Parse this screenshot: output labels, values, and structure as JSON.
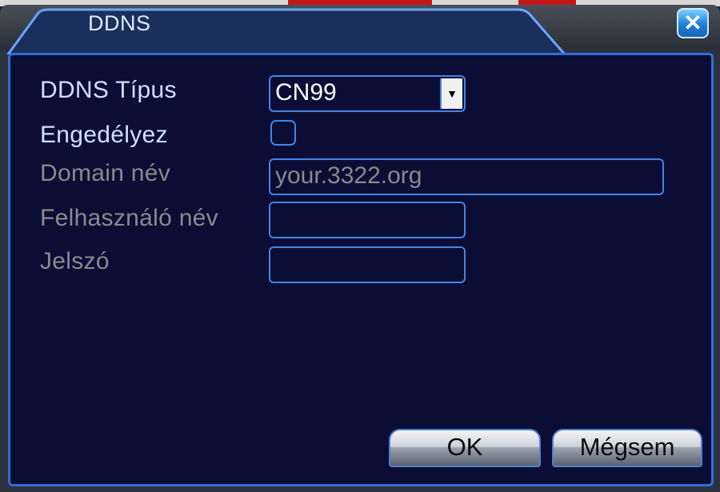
{
  "window": {
    "title": "DDNS"
  },
  "form": {
    "type_label": "DDNS Típus",
    "type_value": "CN99",
    "enable_label": "Engedélyez",
    "enable_checked": false,
    "domain_label": "Domain név",
    "domain_value": "your.3322.org",
    "user_label": "Felhasználó név",
    "user_value": "",
    "password_label": "Jelszó",
    "password_value": ""
  },
  "buttons": {
    "ok": "OK",
    "cancel": "Mégsem"
  },
  "icons": {
    "close": "close-icon",
    "dropdown": "chevron-down-icon"
  },
  "colors": {
    "panel_bg": "#0b0d35",
    "accent_border": "#3f86e8",
    "close_blue": "#1d7fd8"
  }
}
